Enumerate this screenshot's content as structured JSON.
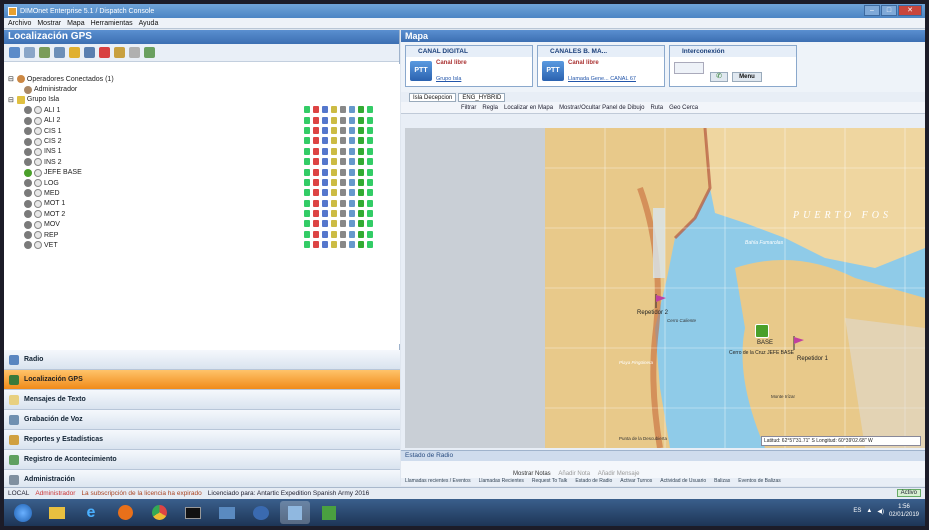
{
  "window": {
    "title": "DIMOnet Enterprise 5.1 / Dispatch Console"
  },
  "menu": [
    "Archivo",
    "Mostrar",
    "Mapa",
    "Herramientas",
    "Ayuda"
  ],
  "left": {
    "title": "Localización GPS",
    "tree": {
      "operators": "Operadores Conectados (1)",
      "admin": "Administrador",
      "group": "Grupo Isla",
      "units": [
        "ALI 1",
        "ALI 2",
        "CIS 1",
        "CIS 2",
        "INS 1",
        "INS 2",
        "JEFE BASE",
        "LOG",
        "MED",
        "MOT 1",
        "MOT 2",
        "MOV",
        "REP",
        "VET"
      ]
    },
    "nav": [
      "Radio",
      "Localización GPS",
      "Mensajes de Texto",
      "Grabación de Voz",
      "Reportes y Estadísticas",
      "Registro de Acontecimiento",
      "Administración"
    ]
  },
  "right": {
    "title": "Mapa",
    "channels": [
      {
        "name": "CANAL DIGITAL",
        "status": "Canal libre",
        "link": "Grupo Isla",
        "ptt": "PTT"
      },
      {
        "name": "CANALES B. MA...",
        "status": "Canal libre",
        "link": "Llamada Gene... CANAL 67",
        "ptt": "PTT"
      },
      {
        "name": "Interconexión",
        "status": "",
        "link": "",
        "ptt": "Menu"
      }
    ],
    "tabs": [
      "Isla Decepcion",
      "ENG_HYBRID"
    ],
    "map_toolbar": [
      "Filtrar",
      "Regla",
      "Localizar en Mapa",
      "Mostrar/Ocultar Panel de Dibujo",
      "Ruta",
      "Geo Cerca"
    ],
    "map_labels": {
      "puerto": "PUERTO  FOS",
      "bahia": "Bahía Fumarolas",
      "rep2": "Repetidor 2",
      "cerro": "Cerro Caliente",
      "base": "BASE",
      "jefe": "Cerro de la Cruz JEFE BASE",
      "rep1": "Repetidor 1",
      "playa": "Playa Pingüinera",
      "monte": "Monte Irízar",
      "punta": "Punta de la Descubierta"
    },
    "coords": "Latitud: 62°57'31.71\" S  Longitud: 60°39'02.68\" W",
    "radio": {
      "title": "Estado de Radio",
      "notes": "Mostrar Notas",
      "add_note": "Añadir Nota",
      "add_msg": "Añadir Mensaje",
      "tabs": [
        "Llamadas recientes / Eventos",
        "Llamadas Recientes",
        "Request To Talk",
        "Estado de Radio",
        "Activar Turnos",
        "Actividad de Usuario",
        "Balizas",
        "Eventos de Balizas"
      ]
    }
  },
  "status": {
    "local": "LOCAL",
    "admin": "Administrador",
    "warning": "La subscripción de la licencia ha expirado",
    "licensed": "Licenciado para: Antartic Expedition Spanish Army 2016",
    "online": "Activo"
  },
  "clock": {
    "time": "1:56",
    "date": "02/01/2019"
  },
  "colors": {
    "accent": "#3c6fb2",
    "active_nav": "#f08a1a",
    "map_sea": "#8fcbe8",
    "map_land": "#e8c98a"
  }
}
